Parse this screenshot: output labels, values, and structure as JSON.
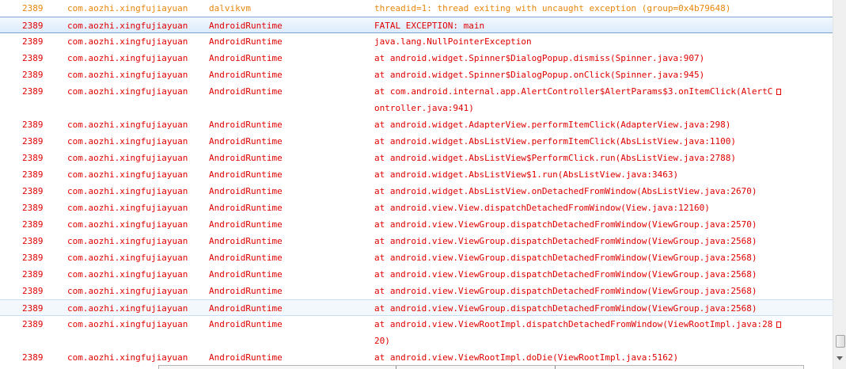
{
  "colors": {
    "error": "#e00000",
    "warn": "#e7860c",
    "selection": "#dcebfc"
  },
  "log": [
    {
      "pid": "2389",
      "app": "com.aozhi.xingfujiayuan",
      "tag": "dalvikvm",
      "msg": "threadid=1: thread exiting with uncaught exception (group=0x4b79648)",
      "level": "warn"
    },
    {
      "pid": "2389",
      "app": "com.aozhi.xingfujiayuan",
      "tag": "AndroidRuntime",
      "msg": "FATAL EXCEPTION: main",
      "level": "error",
      "selected": true
    },
    {
      "pid": "2389",
      "app": "com.aozhi.xingfujiayuan",
      "tag": "AndroidRuntime",
      "msg": "java.lang.NullPointerException",
      "level": "error"
    },
    {
      "pid": "2389",
      "app": "com.aozhi.xingfujiayuan",
      "tag": "AndroidRuntime",
      "msg": "at android.widget.Spinner$DialogPopup.dismiss(Spinner.java:907)",
      "level": "error"
    },
    {
      "pid": "2389",
      "app": "com.aozhi.xingfujiayuan",
      "tag": "AndroidRuntime",
      "msg": "at android.widget.Spinner$DialogPopup.onClick(Spinner.java:945)",
      "level": "error"
    },
    {
      "pid": "2389",
      "app": "com.aozhi.xingfujiayuan",
      "tag": "AndroidRuntime",
      "msg": "at com.android.internal.app.AlertController$AlertParams$3.onItemClick(AlertC",
      "msg2": "ontroller.java:941)",
      "level": "error"
    },
    {
      "pid": "2389",
      "app": "com.aozhi.xingfujiayuan",
      "tag": "AndroidRuntime",
      "msg": "at android.widget.AdapterView.performItemClick(AdapterView.java:298)",
      "level": "error"
    },
    {
      "pid": "2389",
      "app": "com.aozhi.xingfujiayuan",
      "tag": "AndroidRuntime",
      "msg": "at android.widget.AbsListView.performItemClick(AbsListView.java:1100)",
      "level": "error"
    },
    {
      "pid": "2389",
      "app": "com.aozhi.xingfujiayuan",
      "tag": "AndroidRuntime",
      "msg": "at android.widget.AbsListView$PerformClick.run(AbsListView.java:2788)",
      "level": "error"
    },
    {
      "pid": "2389",
      "app": "com.aozhi.xingfujiayuan",
      "tag": "AndroidRuntime",
      "msg": "at android.widget.AbsListView$1.run(AbsListView.java:3463)",
      "level": "error"
    },
    {
      "pid": "2389",
      "app": "com.aozhi.xingfujiayuan",
      "tag": "AndroidRuntime",
      "msg": "at android.widget.AbsListView.onDetachedFromWindow(AbsListView.java:2670)",
      "level": "error"
    },
    {
      "pid": "2389",
      "app": "com.aozhi.xingfujiayuan",
      "tag": "AndroidRuntime",
      "msg": "at android.view.View.dispatchDetachedFromWindow(View.java:12160)",
      "level": "error"
    },
    {
      "pid": "2389",
      "app": "com.aozhi.xingfujiayuan",
      "tag": "AndroidRuntime",
      "msg": "at android.view.ViewGroup.dispatchDetachedFromWindow(ViewGroup.java:2570)",
      "level": "error"
    },
    {
      "pid": "2389",
      "app": "com.aozhi.xingfujiayuan",
      "tag": "AndroidRuntime",
      "msg": "at android.view.ViewGroup.dispatchDetachedFromWindow(ViewGroup.java:2568)",
      "level": "error"
    },
    {
      "pid": "2389",
      "app": "com.aozhi.xingfujiayuan",
      "tag": "AndroidRuntime",
      "msg": "at android.view.ViewGroup.dispatchDetachedFromWindow(ViewGroup.java:2568)",
      "level": "error"
    },
    {
      "pid": "2389",
      "app": "com.aozhi.xingfujiayuan",
      "tag": "AndroidRuntime",
      "msg": "at android.view.ViewGroup.dispatchDetachedFromWindow(ViewGroup.java:2568)",
      "level": "error"
    },
    {
      "pid": "2389",
      "app": "com.aozhi.xingfujiayuan",
      "tag": "AndroidRuntime",
      "msg": "at android.view.ViewGroup.dispatchDetachedFromWindow(ViewGroup.java:2568)",
      "level": "error"
    },
    {
      "pid": "2389",
      "app": "com.aozhi.xingfujiayuan",
      "tag": "AndroidRuntime",
      "msg": "at android.view.ViewGroup.dispatchDetachedFromWindow(ViewGroup.java:2568)",
      "level": "error",
      "hover": true
    },
    {
      "pid": "2389",
      "app": "com.aozhi.xingfujiayuan",
      "tag": "AndroidRuntime",
      "msg": "at android.view.ViewRootImpl.dispatchDetachedFromWindow(ViewRootImpl.java:28",
      "msg2": "20)",
      "level": "error"
    },
    {
      "pid": "2389",
      "app": "com.aozhi.xingfujiayuan",
      "tag": "AndroidRuntime",
      "msg": "at android.view.ViewRootImpl.doDie(ViewRootImpl.java:5162)",
      "level": "error"
    }
  ]
}
